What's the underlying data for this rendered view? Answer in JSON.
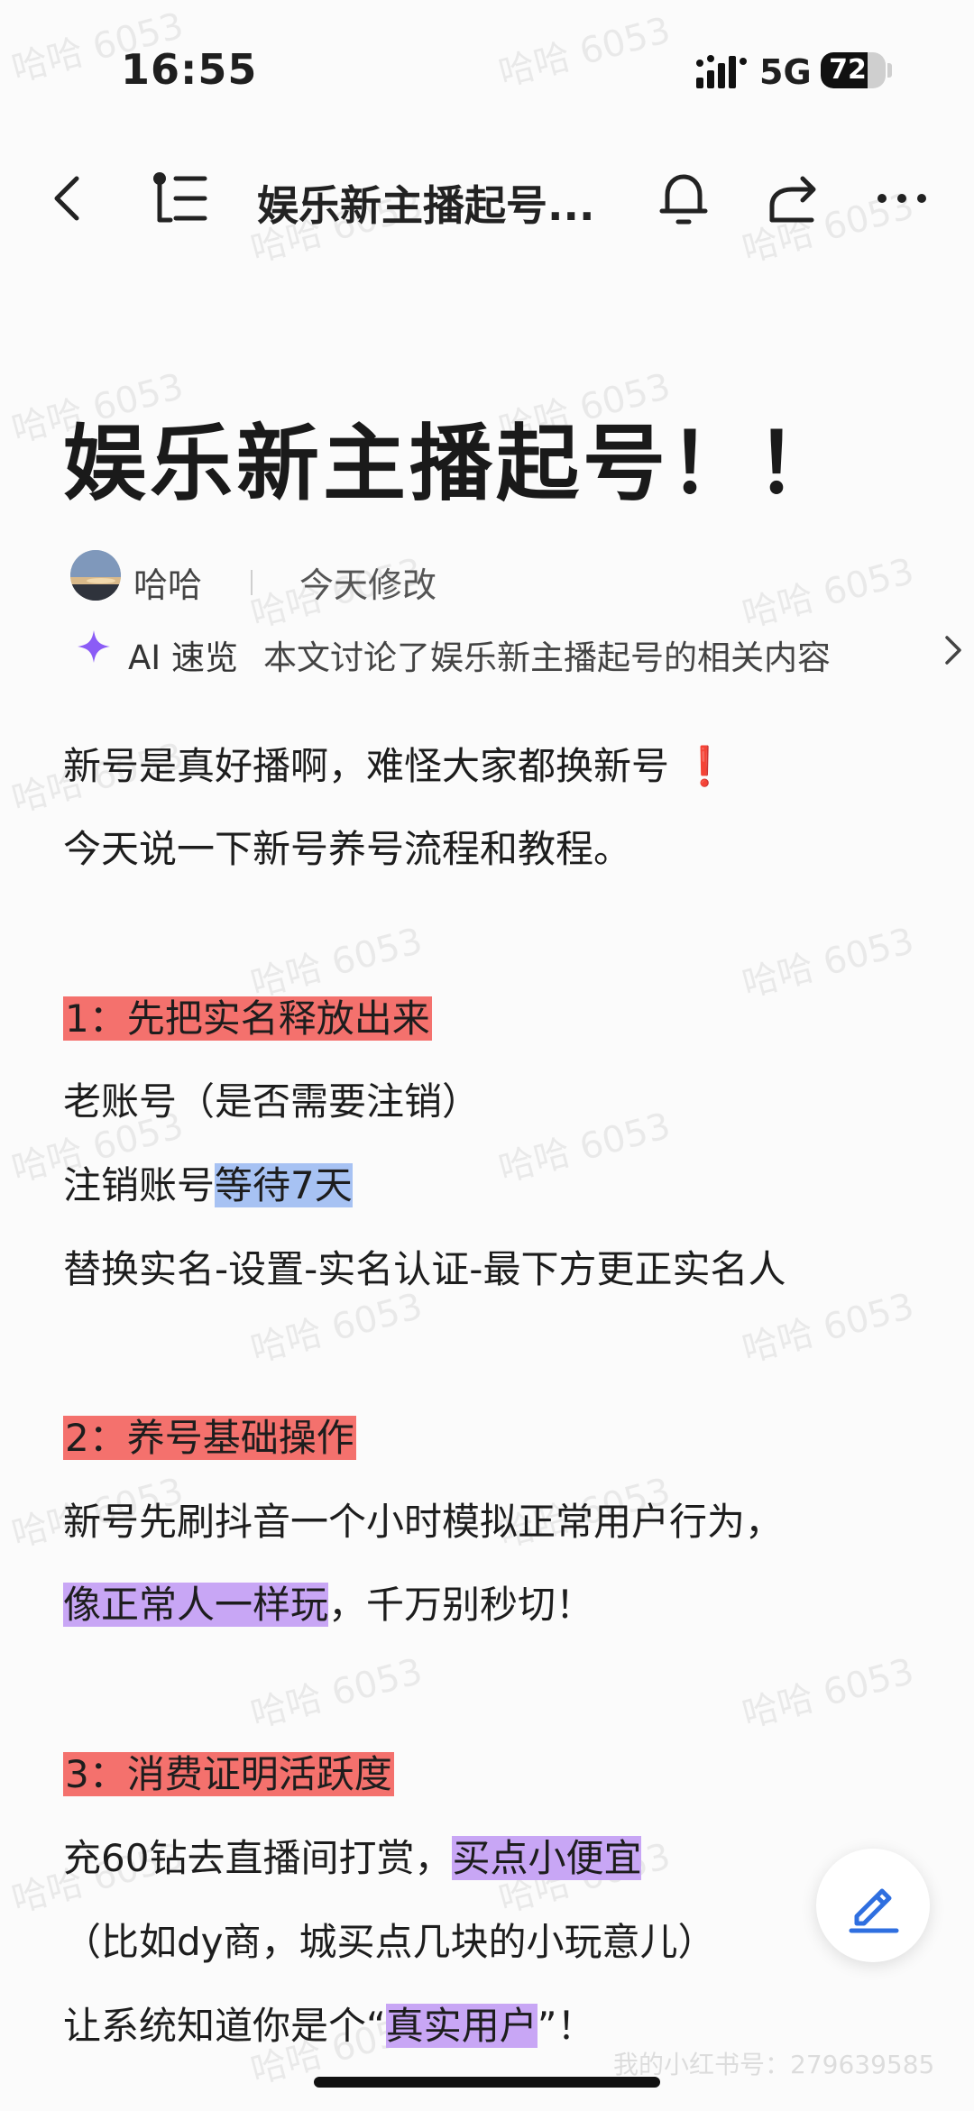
{
  "status_bar": {
    "time": "16:55",
    "network": "5G",
    "battery": "72",
    "battery_level": 0.72
  },
  "nav": {
    "title": "娱乐新主播起号...",
    "icons": [
      "back-icon",
      "outline-icon",
      "bell-icon",
      "share-icon",
      "more-icon"
    ]
  },
  "doc": {
    "title": "娱乐新主播起号！！",
    "author": "哈哈",
    "modified": "今天修改",
    "ai_label": "AI 速览",
    "ai_summary": "本文讨论了娱乐新主播起号的相关内容",
    "body": {
      "l1": "新号是真好播啊，难怪大家都换新号",
      "l1_mark": "❗",
      "l2": "今天说一下新号养号流程和教程。",
      "s1_heading": "1：先把实名释放出来",
      "s1_l1": "老账号（是否需要注销）",
      "s1_l2a": "注销账号",
      "s1_l2b": "等待7天",
      "s1_l3": "替换实名-设置-实名认证-最下方更正实名人",
      "s2_heading": "2：养号基础操作",
      "s2_l1": "新号先刷抖音一个小时模拟正常用户行为，",
      "s2_l2a": "像正常人一样玩",
      "s2_l2b": "，千万别秒切！",
      "s3_heading": "3：消费证明活跃度",
      "s3_l1a": "充60钻去直播间打赏，",
      "s3_l1b": "买点小便宜",
      "s3_l2": "（比如dy商，城买点几块的小玩意儿）",
      "s3_l3a": "让系统知道你是个“",
      "s3_l3b": "真实用户",
      "s3_l3c": "”！"
    }
  },
  "watermark": "哈哈 6053",
  "credit": "我的小红书号：279639585",
  "colors": {
    "highlight_red": "#f4716d",
    "highlight_blue": "#a7c2f3",
    "highlight_purple": "#c8a6f5",
    "ai_sparkle": "#8b5cf6",
    "fab_pen": "#2f6fe0"
  }
}
